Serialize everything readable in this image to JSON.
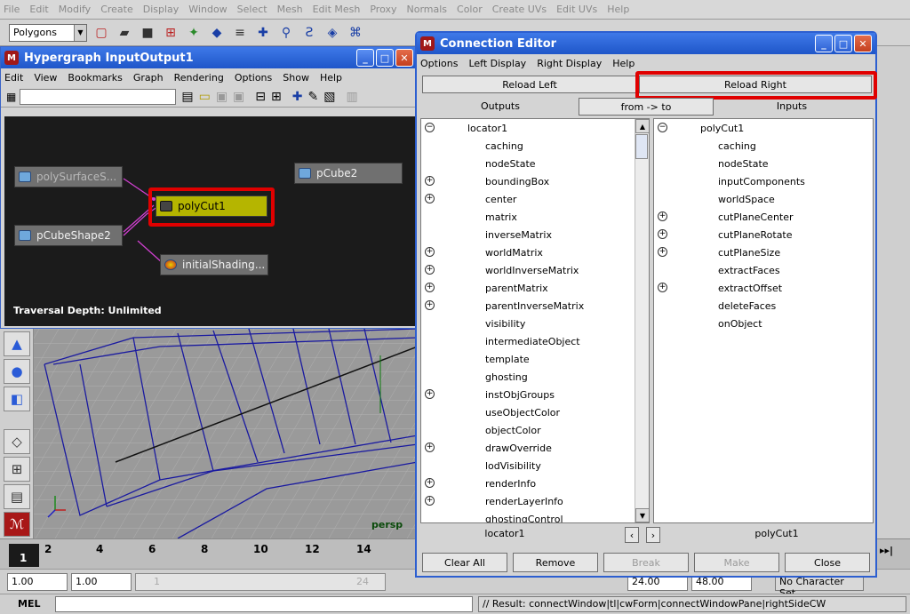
{
  "main_menu": [
    "File",
    "Edit",
    "Modify",
    "Create",
    "Display",
    "Window",
    "Select",
    "Mesh",
    "Edit Mesh",
    "Proxy",
    "Normals",
    "Color",
    "Create UVs",
    "Edit UVs",
    "Help"
  ],
  "shelf": {
    "mode_selector": "Polygons"
  },
  "hypergraph": {
    "title": "Hypergraph InputOutput1",
    "menu": [
      "Edit",
      "View",
      "Bookmarks",
      "Graph",
      "Rendering",
      "Options",
      "Show",
      "Help"
    ],
    "nodes": {
      "poly_surface": "polySurfaceS...",
      "pcube_shape": "pCubeShape2",
      "poly_cut": "polyCut1",
      "pcube2": "pCube2",
      "initial_shading": "initialShading..."
    },
    "traversal_depth": "Traversal Depth: Unlimited"
  },
  "viewport": {
    "label": "persp"
  },
  "connection_editor": {
    "title": "Connection Editor",
    "menu": [
      "Options",
      "Left Display",
      "Right Display",
      "Help"
    ],
    "reload_left": "Reload Left",
    "reload_right": "Reload Right",
    "outputs_header": "Outputs",
    "direction": "from -> to",
    "inputs_header": "Inputs",
    "left_list": {
      "root": "locator1",
      "items": [
        {
          "label": "caching",
          "expandable": false
        },
        {
          "label": "nodeState",
          "expandable": false
        },
        {
          "label": "boundingBox",
          "expandable": true
        },
        {
          "label": "center",
          "expandable": true
        },
        {
          "label": "matrix",
          "expandable": false
        },
        {
          "label": "inverseMatrix",
          "expandable": false
        },
        {
          "label": "worldMatrix",
          "expandable": true
        },
        {
          "label": "worldInverseMatrix",
          "expandable": true
        },
        {
          "label": "parentMatrix",
          "expandable": true
        },
        {
          "label": "parentInverseMatrix",
          "expandable": true
        },
        {
          "label": "visibility",
          "expandable": false
        },
        {
          "label": "intermediateObject",
          "expandable": false
        },
        {
          "label": "template",
          "expandable": false
        },
        {
          "label": "ghosting",
          "expandable": false
        },
        {
          "label": "instObjGroups",
          "expandable": true
        },
        {
          "label": "useObjectColor",
          "expandable": false
        },
        {
          "label": "objectColor",
          "expandable": false
        },
        {
          "label": "drawOverride",
          "expandable": true
        },
        {
          "label": "lodVisibility",
          "expandable": false
        },
        {
          "label": "renderInfo",
          "expandable": true
        },
        {
          "label": "renderLayerInfo",
          "expandable": true
        },
        {
          "label": "ghostingControl",
          "expandable": false
        }
      ]
    },
    "right_list": {
      "root": "polyCut1",
      "items": [
        {
          "label": "caching",
          "expandable": false
        },
        {
          "label": "nodeState",
          "expandable": false
        },
        {
          "label": "inputComponents",
          "expandable": false
        },
        {
          "label": "worldSpace",
          "expandable": false
        },
        {
          "label": "cutPlaneCenter",
          "expandable": true
        },
        {
          "label": "cutPlaneRotate",
          "expandable": true
        },
        {
          "label": "cutPlaneSize",
          "expandable": true
        },
        {
          "label": "extractFaces",
          "expandable": false
        },
        {
          "label": "extractOffset",
          "expandable": true
        },
        {
          "label": "deleteFaces",
          "expandable": false
        },
        {
          "label": "onObject",
          "expandable": false
        }
      ]
    },
    "left_node_name": "locator1",
    "right_node_name": "polyCut1",
    "buttons": {
      "clear_all": "Clear All",
      "remove": "Remove",
      "break": "Break",
      "make": "Make",
      "close": "Close"
    }
  },
  "timeline": {
    "ticks": [
      "2",
      "4",
      "6",
      "8",
      "10",
      "12",
      "14"
    ],
    "current_frame": "1"
  },
  "range": {
    "start": "1.00",
    "start2": "1.00",
    "slider_start": "1",
    "slider_end": "24",
    "end": "24.00",
    "end2": "48.00",
    "char_set": "No Character Set"
  },
  "command_line": {
    "label": "MEL",
    "result": "// Result: connectWindow|tl|cwForm|connectWindowPane|rightSideCW"
  }
}
